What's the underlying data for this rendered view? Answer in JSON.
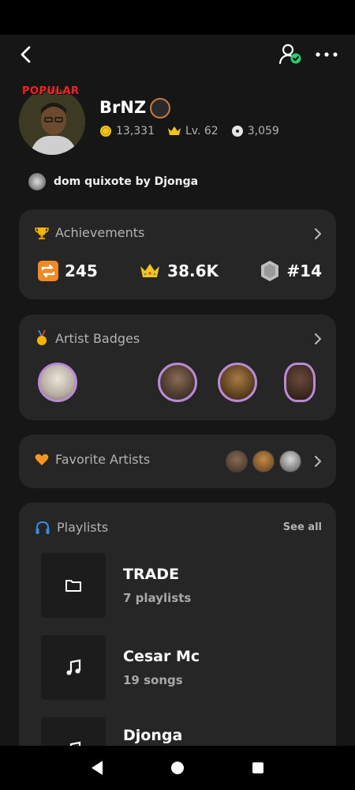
{
  "profile": {
    "name": "BrNZ",
    "badge_text": "POPULAR",
    "coins": "13,331",
    "level": "Lv. 62",
    "discs": "3,059",
    "now_playing": "dom quixote by Djonga"
  },
  "achievements": {
    "title": "Achievements",
    "repeats": "245",
    "crowns": "38.6K",
    "rank": "#14"
  },
  "artist_badges": {
    "title": "Artist Badges"
  },
  "favorite_artists": {
    "title": "Favorite Artists"
  },
  "playlists": {
    "title": "Playlists",
    "see_all": "See all",
    "items": [
      {
        "title": "TRADE",
        "subtitle": "7 playlists",
        "icon": "folder-icon"
      },
      {
        "title": "Cesar Mc",
        "subtitle": "19 songs",
        "icon": "music-note-icon"
      },
      {
        "title": "Djonga",
        "subtitle": "",
        "icon": "music-note-icon"
      }
    ]
  },
  "colors": {
    "background": "#161616",
    "card": "#262626",
    "accent_badge_ring": "#b98ad6",
    "popular_red": "#ff1f1f",
    "verified_green": "#2ecc71"
  }
}
